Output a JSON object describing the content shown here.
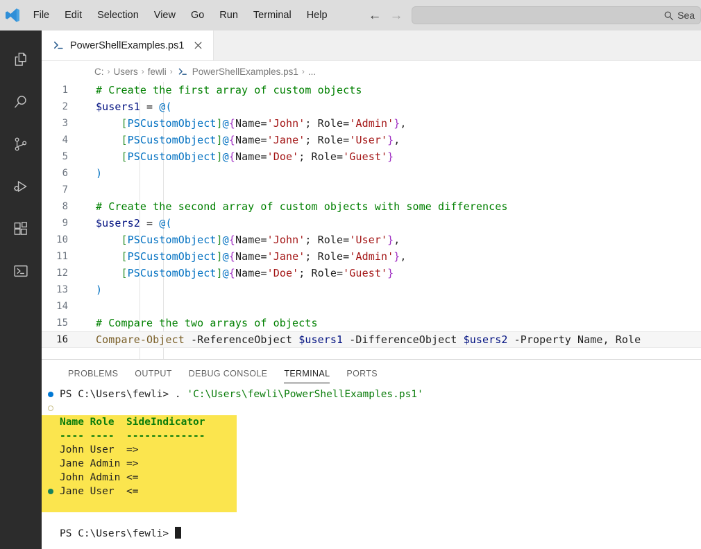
{
  "titlebar": {
    "logo_icon": "vscode-logo-icon",
    "menus": [
      "File",
      "Edit",
      "Selection",
      "View",
      "Go",
      "Run",
      "Terminal",
      "Help"
    ],
    "back_icon": "arrow-left-icon",
    "forward_icon": "arrow-right-icon",
    "command_center": {
      "search_icon": "search-icon",
      "text": "Sea"
    }
  },
  "activitybar": {
    "items": [
      {
        "name": "explorer",
        "icon": "files-icon"
      },
      {
        "name": "search",
        "icon": "search-icon"
      },
      {
        "name": "source-control",
        "icon": "source-control-icon"
      },
      {
        "name": "run-and-debug",
        "icon": "run-and-debug-icon"
      },
      {
        "name": "extensions",
        "icon": "extensions-icon"
      },
      {
        "name": "powershell",
        "icon": "terminal-powershell-icon"
      }
    ]
  },
  "tabs": [
    {
      "icon": "powershell-file-icon",
      "label": "PowerShellExamples.ps1",
      "close_icon": "close-icon",
      "active": true
    }
  ],
  "breadcrumb": {
    "items": [
      "C:",
      "Users",
      "fewli",
      "PowerShellExamples.ps1",
      "..."
    ],
    "file_icon": "powershell-file-icon",
    "separator": "›"
  },
  "editor": {
    "lines": [
      {
        "n": "1",
        "tokens": [
          {
            "t": "# Create the first array of custom objects",
            "c": "t-comment"
          }
        ]
      },
      {
        "n": "2",
        "tokens": [
          {
            "t": "$users1",
            "c": "t-var"
          },
          {
            "t": " = ",
            "c": "t-op"
          },
          {
            "t": "@(",
            "c": "t-at"
          }
        ]
      },
      {
        "n": "3",
        "tokens": [
          {
            "t": "    ",
            "c": "t-op"
          },
          {
            "t": "[",
            "c": "t-bracket-g"
          },
          {
            "t": "PSCustomObject",
            "c": "t-type"
          },
          {
            "t": "]",
            "c": "t-bracket-g"
          },
          {
            "t": "@",
            "c": "t-at"
          },
          {
            "t": "{",
            "c": "t-brace-p"
          },
          {
            "t": "Name=",
            "c": "t-prop"
          },
          {
            "t": "'John'",
            "c": "t-str"
          },
          {
            "t": "; ",
            "c": "t-prop"
          },
          {
            "t": "Role=",
            "c": "t-prop"
          },
          {
            "t": "'Admin'",
            "c": "t-str"
          },
          {
            "t": "}",
            "c": "t-brace-p"
          },
          {
            "t": ",",
            "c": "t-op"
          }
        ]
      },
      {
        "n": "4",
        "tokens": [
          {
            "t": "    ",
            "c": "t-op"
          },
          {
            "t": "[",
            "c": "t-bracket-g"
          },
          {
            "t": "PSCustomObject",
            "c": "t-type"
          },
          {
            "t": "]",
            "c": "t-bracket-g"
          },
          {
            "t": "@",
            "c": "t-at"
          },
          {
            "t": "{",
            "c": "t-brace-p"
          },
          {
            "t": "Name=",
            "c": "t-prop"
          },
          {
            "t": "'Jane'",
            "c": "t-str"
          },
          {
            "t": "; ",
            "c": "t-prop"
          },
          {
            "t": "Role=",
            "c": "t-prop"
          },
          {
            "t": "'User'",
            "c": "t-str"
          },
          {
            "t": "}",
            "c": "t-brace-p"
          },
          {
            "t": ",",
            "c": "t-op"
          }
        ]
      },
      {
        "n": "5",
        "tokens": [
          {
            "t": "    ",
            "c": "t-op"
          },
          {
            "t": "[",
            "c": "t-bracket-g"
          },
          {
            "t": "PSCustomObject",
            "c": "t-type"
          },
          {
            "t": "]",
            "c": "t-bracket-g"
          },
          {
            "t": "@",
            "c": "t-at"
          },
          {
            "t": "{",
            "c": "t-brace-p"
          },
          {
            "t": "Name=",
            "c": "t-prop"
          },
          {
            "t": "'Doe'",
            "c": "t-str"
          },
          {
            "t": "; ",
            "c": "t-prop"
          },
          {
            "t": "Role=",
            "c": "t-prop"
          },
          {
            "t": "'Guest'",
            "c": "t-str"
          },
          {
            "t": "}",
            "c": "t-brace-p"
          }
        ]
      },
      {
        "n": "6",
        "tokens": [
          {
            "t": ")",
            "c": "t-at"
          }
        ]
      },
      {
        "n": "7",
        "tokens": []
      },
      {
        "n": "8",
        "tokens": [
          {
            "t": "# Create the second array of custom objects with some differences",
            "c": "t-comment"
          }
        ]
      },
      {
        "n": "9",
        "tokens": [
          {
            "t": "$users2",
            "c": "t-var"
          },
          {
            "t": " = ",
            "c": "t-op"
          },
          {
            "t": "@(",
            "c": "t-at"
          }
        ]
      },
      {
        "n": "10",
        "tokens": [
          {
            "t": "    ",
            "c": "t-op"
          },
          {
            "t": "[",
            "c": "t-bracket-g"
          },
          {
            "t": "PSCustomObject",
            "c": "t-type"
          },
          {
            "t": "]",
            "c": "t-bracket-g"
          },
          {
            "t": "@",
            "c": "t-at"
          },
          {
            "t": "{",
            "c": "t-brace-p"
          },
          {
            "t": "Name=",
            "c": "t-prop"
          },
          {
            "t": "'John'",
            "c": "t-str"
          },
          {
            "t": "; ",
            "c": "t-prop"
          },
          {
            "t": "Role=",
            "c": "t-prop"
          },
          {
            "t": "'User'",
            "c": "t-str"
          },
          {
            "t": "}",
            "c": "t-brace-p"
          },
          {
            "t": ",",
            "c": "t-op"
          }
        ]
      },
      {
        "n": "11",
        "tokens": [
          {
            "t": "    ",
            "c": "t-op"
          },
          {
            "t": "[",
            "c": "t-bracket-g"
          },
          {
            "t": "PSCustomObject",
            "c": "t-type"
          },
          {
            "t": "]",
            "c": "t-bracket-g"
          },
          {
            "t": "@",
            "c": "t-at"
          },
          {
            "t": "{",
            "c": "t-brace-p"
          },
          {
            "t": "Name=",
            "c": "t-prop"
          },
          {
            "t": "'Jane'",
            "c": "t-str"
          },
          {
            "t": "; ",
            "c": "t-prop"
          },
          {
            "t": "Role=",
            "c": "t-prop"
          },
          {
            "t": "'Admin'",
            "c": "t-str"
          },
          {
            "t": "}",
            "c": "t-brace-p"
          },
          {
            "t": ",",
            "c": "t-op"
          }
        ]
      },
      {
        "n": "12",
        "tokens": [
          {
            "t": "    ",
            "c": "t-op"
          },
          {
            "t": "[",
            "c": "t-bracket-g"
          },
          {
            "t": "PSCustomObject",
            "c": "t-type"
          },
          {
            "t": "]",
            "c": "t-bracket-g"
          },
          {
            "t": "@",
            "c": "t-at"
          },
          {
            "t": "{",
            "c": "t-brace-p"
          },
          {
            "t": "Name=",
            "c": "t-prop"
          },
          {
            "t": "'Doe'",
            "c": "t-str"
          },
          {
            "t": "; ",
            "c": "t-prop"
          },
          {
            "t": "Role=",
            "c": "t-prop"
          },
          {
            "t": "'Guest'",
            "c": "t-str"
          },
          {
            "t": "}",
            "c": "t-brace-p"
          }
        ]
      },
      {
        "n": "13",
        "tokens": [
          {
            "t": ")",
            "c": "t-at"
          }
        ]
      },
      {
        "n": "14",
        "tokens": []
      },
      {
        "n": "15",
        "tokens": [
          {
            "t": "# Compare the two arrays of objects",
            "c": "t-comment"
          }
        ]
      },
      {
        "n": "16",
        "active": true,
        "tokens": [
          {
            "t": "Compare-Object",
            "c": "t-fn"
          },
          {
            "t": " -ReferenceObject ",
            "c": "t-param"
          },
          {
            "t": "$users1",
            "c": "t-var"
          },
          {
            "t": " -DifferenceObject ",
            "c": "t-param"
          },
          {
            "t": "$users2",
            "c": "t-var"
          },
          {
            "t": " -Property Name, Role",
            "c": "t-param"
          }
        ]
      }
    ]
  },
  "panel": {
    "tabs": [
      {
        "label": "PROBLEMS",
        "active": false
      },
      {
        "label": "OUTPUT",
        "active": false
      },
      {
        "label": "DEBUG CONSOLE",
        "active": false
      },
      {
        "label": "TERMINAL",
        "active": true
      },
      {
        "label": "PORTS",
        "active": false
      }
    ],
    "terminal": {
      "lines": [
        {
          "marker": "blue-dot",
          "highlight": false,
          "segs": [
            {
              "t": "PS C:\\Users\\fewli> ",
              "c": "t-magenta"
            },
            {
              "t": ". ",
              "c": "t-magenta"
            },
            {
              "t": "'C:\\Users\\fewli\\PowerShellExamples.ps1'",
              "c": "t-path"
            }
          ]
        },
        {
          "marker": "hollow-circle",
          "highlight": false,
          "segs": []
        },
        {
          "marker": "none",
          "highlight": true,
          "segs": [
            {
              "t": "Name Role  SideIndicator",
              "c": "t-green"
            }
          ]
        },
        {
          "marker": "none",
          "highlight": true,
          "segs": [
            {
              "t": "---- ----  -------------",
              "c": "t-dash"
            }
          ]
        },
        {
          "marker": "none",
          "highlight": true,
          "segs": [
            {
              "t": "John User  =>",
              "c": "t-magenta"
            }
          ]
        },
        {
          "marker": "none",
          "highlight": true,
          "segs": [
            {
              "t": "Jane Admin =>",
              "c": "t-magenta"
            }
          ]
        },
        {
          "marker": "none",
          "highlight": true,
          "segs": [
            {
              "t": "John Admin <=",
              "c": "t-magenta"
            }
          ]
        },
        {
          "marker": "green-dot",
          "highlight": true,
          "segs": [
            {
              "t": "Jane User  <=",
              "c": "t-magenta"
            }
          ]
        },
        {
          "marker": "none",
          "highlight": true,
          "segs": []
        },
        {
          "marker": "none",
          "highlight": false,
          "segs": []
        },
        {
          "marker": "none",
          "highlight": false,
          "segs": [
            {
              "t": "PS C:\\Users\\fewli> ",
              "c": "t-magenta"
            }
          ],
          "cursor": true
        }
      ]
    }
  },
  "colors": {
    "titlebar_bg": "#dddddd",
    "activitybar_bg": "#2c2c2c",
    "editor_bg": "#ffffff",
    "accent_blue": "#0078d4",
    "success_green": "#16825d",
    "output_highlight": "#fbe54e",
    "comment_green": "#008000",
    "string_red": "#a31515",
    "variable_blue": "#001080"
  }
}
